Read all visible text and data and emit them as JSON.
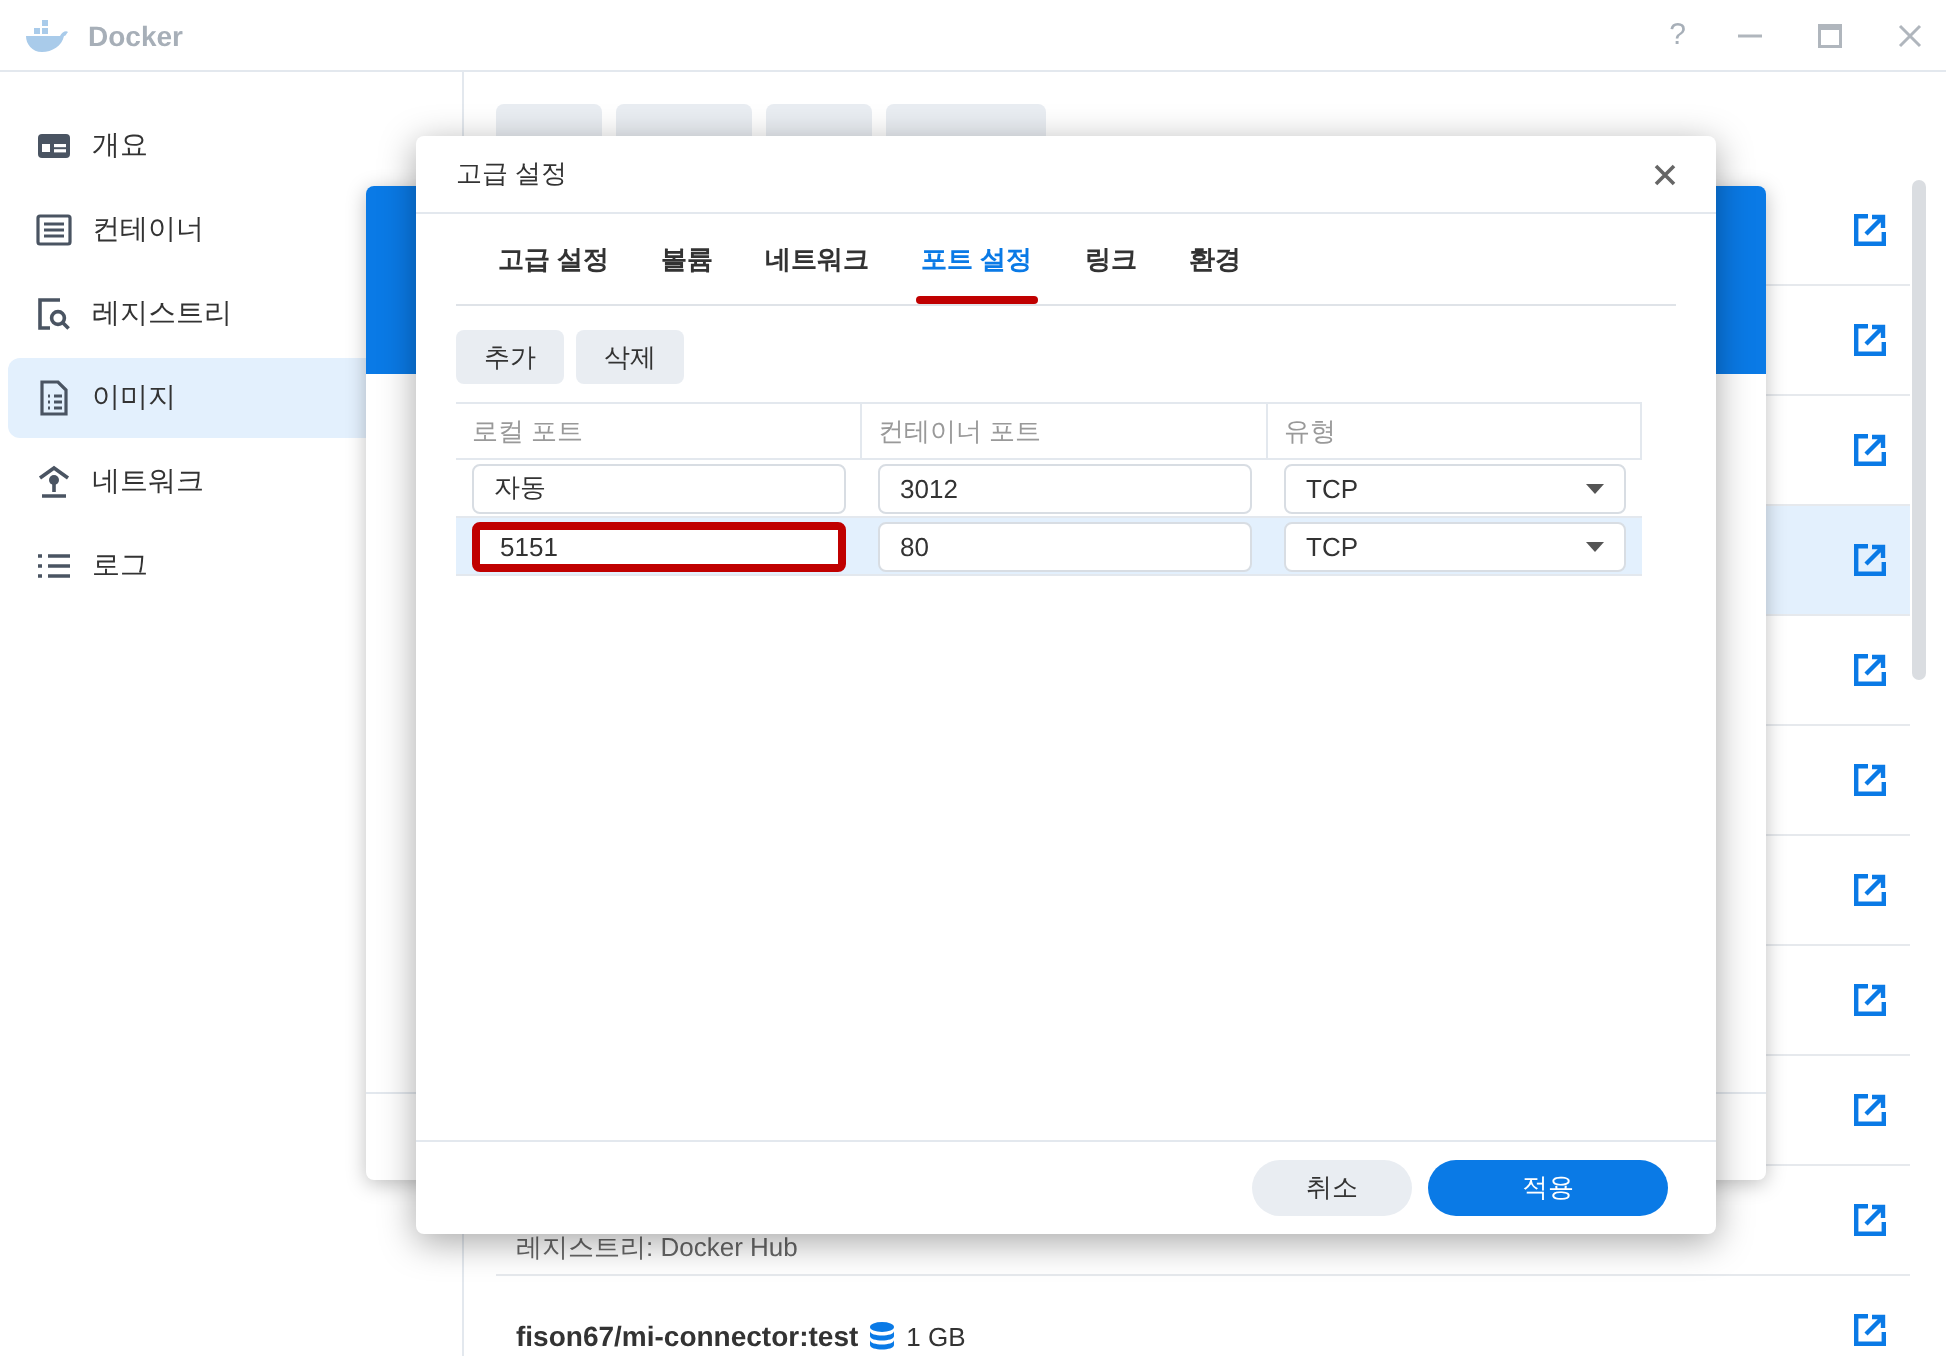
{
  "window": {
    "title": "Docker",
    "help": "?"
  },
  "sidebar": {
    "items": [
      {
        "label": "개요",
        "selected": false
      },
      {
        "label": "컨테이너",
        "selected": false
      },
      {
        "label": "레지스트리",
        "selected": false
      },
      {
        "label": "이미지",
        "selected": true
      },
      {
        "label": "네트워크",
        "selected": false
      },
      {
        "label": "로그",
        "selected": false
      }
    ]
  },
  "image_list": {
    "rows": [
      {
        "selected": false
      },
      {
        "selected": false
      },
      {
        "selected": false
      },
      {
        "selected": true
      },
      {
        "selected": false
      },
      {
        "selected": false
      },
      {
        "selected": false
      },
      {
        "selected": false
      },
      {
        "selected": false
      },
      {
        "selected": false,
        "detail": "레지스트리: Docker Hub"
      },
      {
        "selected": false,
        "name": "fison67/mi-connector:test",
        "size": "1 GB"
      }
    ]
  },
  "dialog": {
    "title": "고급 설정",
    "tabs": [
      {
        "label": "고급 설정",
        "selected": false
      },
      {
        "label": "볼륨",
        "selected": false
      },
      {
        "label": "네트워크",
        "selected": false
      },
      {
        "label": "포트 설정",
        "selected": true
      },
      {
        "label": "링크",
        "selected": false
      },
      {
        "label": "환경",
        "selected": false
      }
    ],
    "buttons": [
      "추가",
      "삭제"
    ],
    "table": {
      "columns": [
        "로컬 포트",
        "컨테이너 포트",
        "유형"
      ],
      "rows": [
        {
          "local_port": "자동",
          "container_port": "3012",
          "type": "TCP",
          "selected": false,
          "highlighted": false
        },
        {
          "local_port": "5151",
          "container_port": "80",
          "type": "TCP",
          "selected": true,
          "highlighted": true
        }
      ]
    },
    "cancel": "취소",
    "apply": "적용"
  }
}
